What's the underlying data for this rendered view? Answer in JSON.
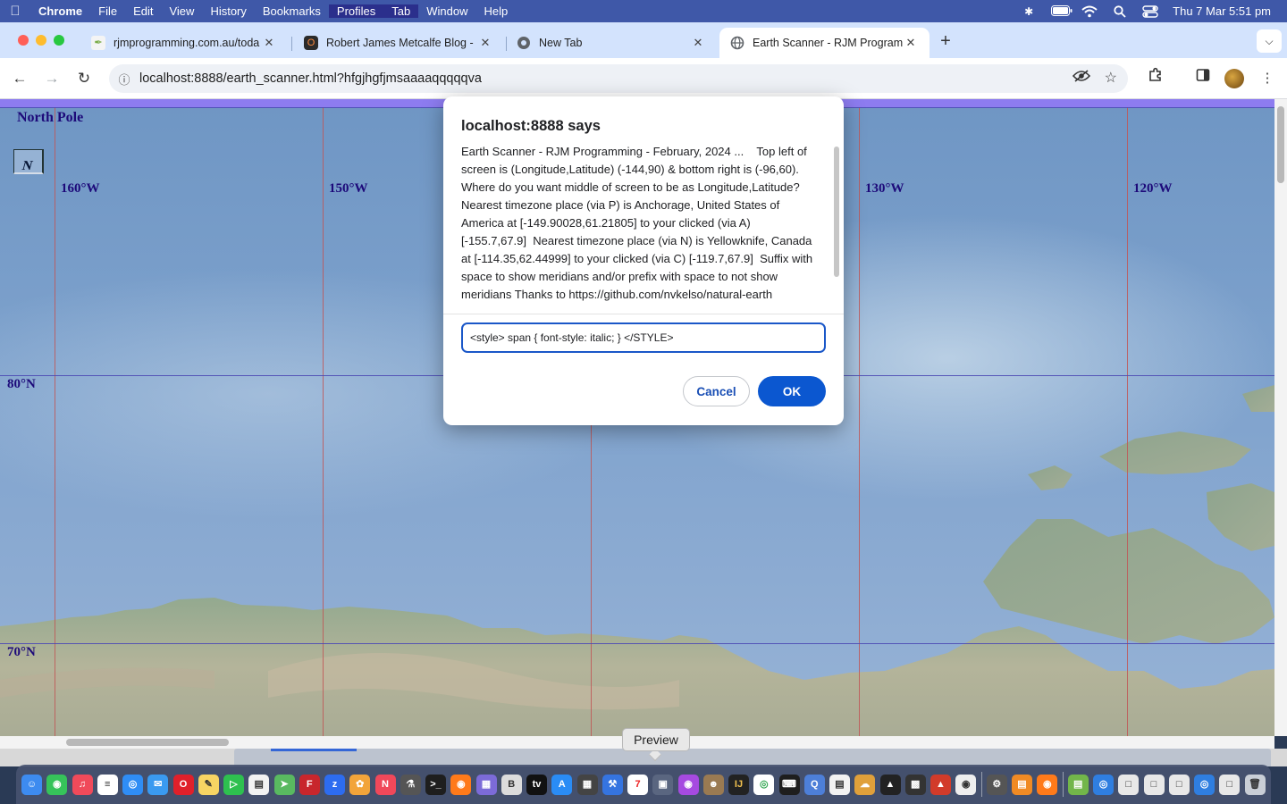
{
  "menubar": {
    "app": "Chrome",
    "items": [
      "File",
      "Edit",
      "View",
      "History",
      "Bookmarks",
      "Profiles",
      "Tab",
      "Window",
      "Help"
    ],
    "clock": "Thu 7 Mar  5:51 pm"
  },
  "tabs": [
    {
      "title": "rjmprogramming.com.au/toda",
      "active": false
    },
    {
      "title": "Robert James Metcalfe Blog -",
      "active": false
    },
    {
      "title": "New Tab",
      "active": false
    },
    {
      "title": "Earth Scanner - RJM Program",
      "active": true
    }
  ],
  "omnibox": {
    "url": "localhost:8888/earth_scanner.html?hfgjhgfjmsaaaaqqqqqva"
  },
  "map": {
    "north_pole_label": "North Pole",
    "north_marker": "N",
    "longitude_labels": [
      "160°W",
      "150°W",
      "130°W",
      "120°W"
    ],
    "latitude_labels": [
      "80°N",
      "70°N"
    ]
  },
  "dialog": {
    "title": "localhost:8888 says",
    "message": "Earth Scanner - RJM Programming - February, 2024 ...    Top left of screen is (Longitude,Latitude) (-144,90) & bottom right is (-96,60). Where do you want middle of screen to be as Longitude,Latitude?  Nearest timezone place (via P) is Anchorage, United States of America at [-149.90028,61.21805] to your clicked (via A) [-155.7,67.9]  Nearest timezone place (via N) is Yellowknife, Canada at [-114.35,62.44999] to your clicked (via C) [-119.7,67.9]  Suffix with space to show meridians and/or prefix with space to not show meridians Thanks to https://github.com/nvkelso/natural-earth",
    "input_value": "<style> span { font-style: italic; } </STYLE>",
    "cancel_label": "Cancel",
    "ok_label": "OK"
  },
  "tooltip": {
    "text": "Preview"
  },
  "colors": {
    "menubar": "#3f58a8",
    "tabstrip": "#d3e3fd",
    "meridian": "#c05656",
    "parallel": "#4d4ab4",
    "label": "#1d0a7a",
    "ok_button": "#0b57d0"
  }
}
